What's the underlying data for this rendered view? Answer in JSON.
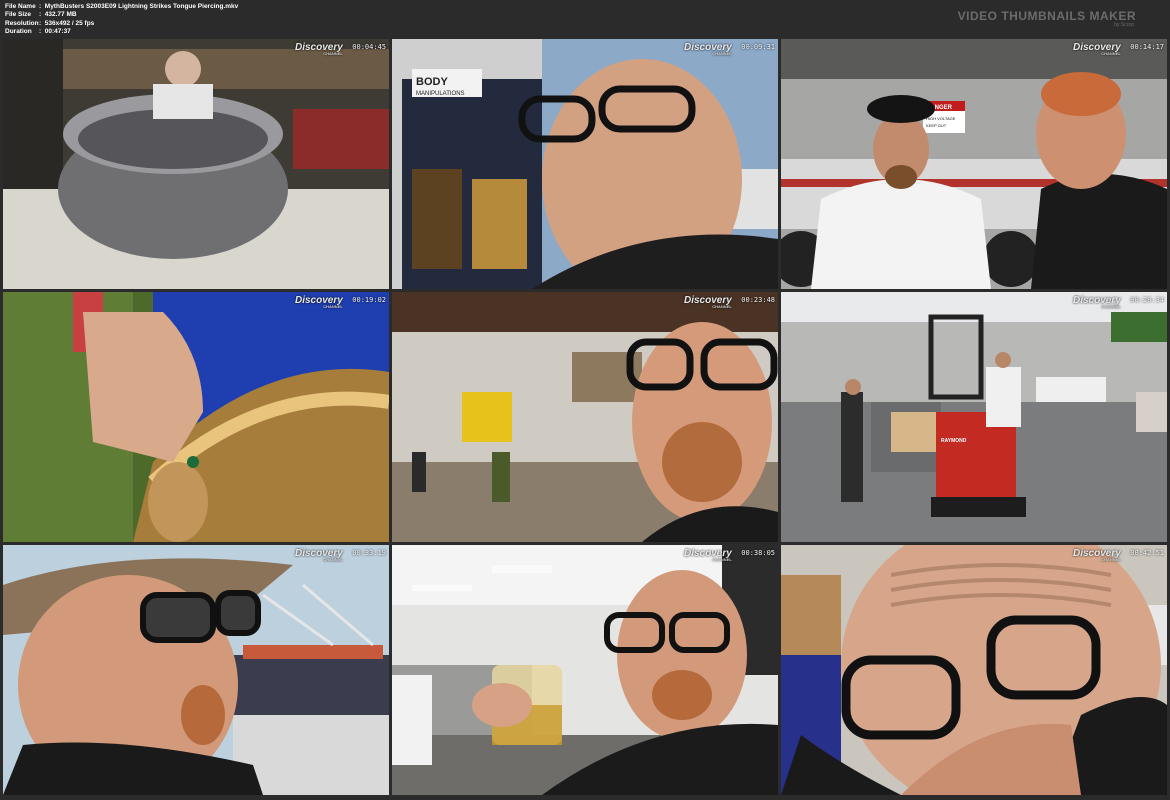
{
  "header": {
    "file_name_label": "File Name",
    "file_name": "MythBusters S2003E09 Lightning Strikes Tongue Piercing.mkv",
    "file_size_label": "File Size",
    "file_size": "432.77 MB",
    "resolution_label": "Resolution",
    "resolution": "536x492 / 25 fps",
    "duration_label": "Duration",
    "duration": "00:47:37",
    "brand": "VIDEO THUMBNAILS MAKER",
    "brand_sub": "by Scorp"
  },
  "channel_logo": "Discovery",
  "channel_logo_sub": "CHANNEL",
  "thumbnails": [
    {
      "timestamp": "00:04:45"
    },
    {
      "timestamp": "00:09:31"
    },
    {
      "timestamp": "00:14:17"
    },
    {
      "timestamp": "00:19:02"
    },
    {
      "timestamp": "00:23:48"
    },
    {
      "timestamp": "00:28:34"
    },
    {
      "timestamp": "00:33:19"
    },
    {
      "timestamp": "00:38:05"
    },
    {
      "timestamp": "00:42:51"
    }
  ],
  "scene_text": {
    "body_sign": "BODY",
    "body_sign_2": "MANIPULATIONS",
    "danger_sign": "DANGER",
    "danger_sub": "HIGH VOLTAGE",
    "danger_sub2": "KEEP OUT",
    "forklift_brand": "RAYMOND"
  }
}
